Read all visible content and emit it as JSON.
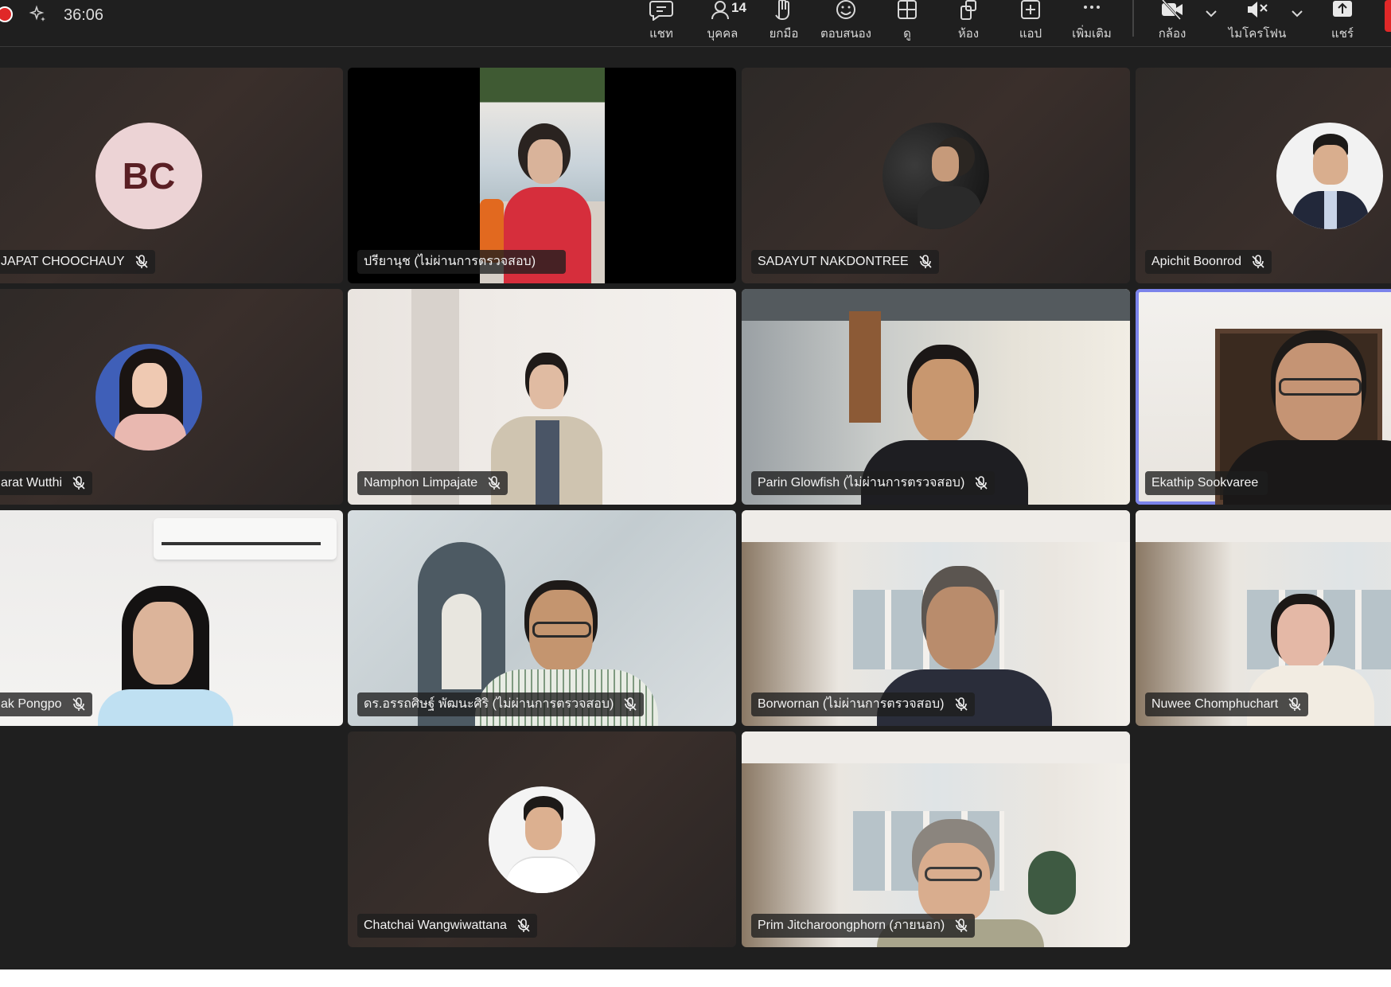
{
  "meeting": {
    "timer": "36:06"
  },
  "toolbar": {
    "chat": "แชท",
    "people": "บุคคล",
    "people_count": "14",
    "raise": "ยกมือ",
    "react": "ตอบสนอง",
    "view": "ดู",
    "rooms": "ห้อง",
    "apps": "แอป",
    "more": "เพิ่มเติม",
    "camera": "กล้อง",
    "mic": "ไมโครโฟน",
    "share": "แชร์"
  },
  "participants": [
    {
      "name": "JAPAT CHOOCHAUY",
      "initials": "BC"
    },
    {
      "name": "ปรียานุช (ไม่ผ่านการตรวจสอบ)"
    },
    {
      "name": "SADAYUT NAKDONTREE"
    },
    {
      "name": "Apichit Boonrod"
    },
    {
      "name": "arat Wutthi"
    },
    {
      "name": "Namphon Limpajate"
    },
    {
      "name": "Parin Glowfish (ไม่ผ่านการตรวจสอบ)"
    },
    {
      "name": "Ekathip Sookvaree"
    },
    {
      "name": "ak Pongpo"
    },
    {
      "name": "ดร.อรรถศิษฐ์ พัฒนะศิริ (ไม่ผ่านการตรวจสอบ)"
    },
    {
      "name": "Borwornan (ไม่ผ่านการตรวจสอบ)"
    },
    {
      "name": "Nuwee Chomphuchart"
    },
    {
      "name": "Chatchai Wangwiwattana"
    },
    {
      "name": "Prim Jitcharoongphorn (ภายนอก)"
    }
  ]
}
